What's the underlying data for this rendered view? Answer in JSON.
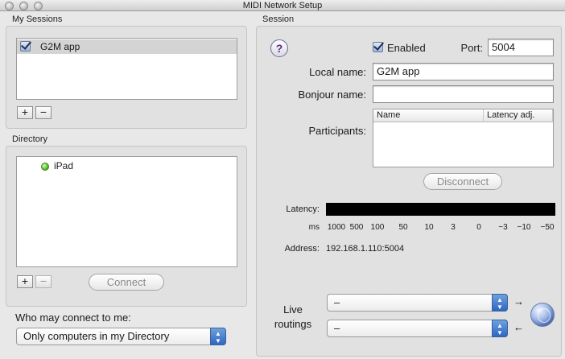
{
  "window": {
    "title": "MIDI Network Setup"
  },
  "sessions": {
    "heading": "My Sessions",
    "items": [
      {
        "label": "G2M app",
        "checked": true
      }
    ],
    "add_label": "+",
    "remove_label": "−"
  },
  "directory": {
    "heading": "Directory",
    "items": [
      {
        "label": "iPad",
        "status": "online"
      }
    ],
    "add_label": "+",
    "remove_label": "−",
    "connect_label": "Connect"
  },
  "access": {
    "label": "Who may connect to me:",
    "selected": "Only computers in my Directory"
  },
  "session": {
    "heading": "Session",
    "help_label": "?",
    "enabled_label": "Enabled",
    "enabled": true,
    "port_label": "Port:",
    "port_value": "5004",
    "local_name_label": "Local name:",
    "local_name_value": "G2M app",
    "bonjour_name_label": "Bonjour name:",
    "bonjour_name_value": "",
    "participants_label": "Participants:",
    "participants_columns": [
      "Name",
      "Latency adj."
    ],
    "disconnect_label": "Disconnect",
    "latency_label": "Latency:",
    "latency_unit": "ms",
    "latency_ticks": [
      "1000",
      "500",
      "100",
      "50",
      "10",
      "3",
      "0",
      "−3",
      "−10",
      "−50"
    ],
    "address_label": "Address:",
    "address_value": "192.168.1.110:5004",
    "live_routings_label_1": "Live",
    "live_routings_label_2": "routings",
    "routing_out_value": "–",
    "routing_in_value": "–",
    "arrow_right": "→",
    "arrow_left": "←"
  }
}
